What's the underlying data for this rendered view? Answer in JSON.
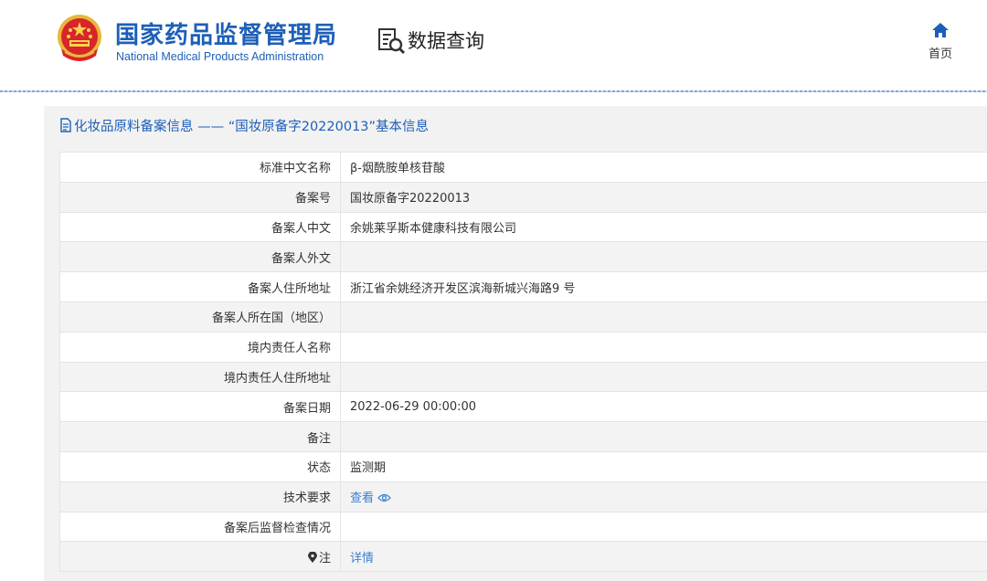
{
  "header": {
    "site_title_cn": "国家药品监督管理局",
    "site_title_en": "National Medical Products Administration",
    "query_title": "数据查询",
    "home_label": "首页",
    "accent_color": "#1d5fb8"
  },
  "panel": {
    "title": "化妆品原料备案信息 —— “国妆原备字20220013”基本信息"
  },
  "rows": [
    {
      "label": "标准中文名称",
      "value": "β-烟酰胺单核苷酸"
    },
    {
      "label": "备案号",
      "value": "国妆原备字20220013"
    },
    {
      "label": "备案人中文",
      "value": "余姚莱孚斯本健康科技有限公司"
    },
    {
      "label": "备案人外文",
      "value": ""
    },
    {
      "label": "备案人住所地址",
      "value": "浙江省余姚经济开发区滨海新城兴海路9 号"
    },
    {
      "label": "备案人所在国（地区）",
      "value": ""
    },
    {
      "label": "境内责任人名称",
      "value": ""
    },
    {
      "label": "境内责任人住所地址",
      "value": ""
    },
    {
      "label": "备案日期",
      "value": "2022-06-29 00:00:00"
    },
    {
      "label": "备注",
      "value": ""
    },
    {
      "label": "状态",
      "value": "监测期"
    },
    {
      "label": "技术要求",
      "value": "查看"
    },
    {
      "label": "备案后监督检查情况",
      "value": ""
    },
    {
      "label": "注",
      "value": "详情"
    }
  ]
}
